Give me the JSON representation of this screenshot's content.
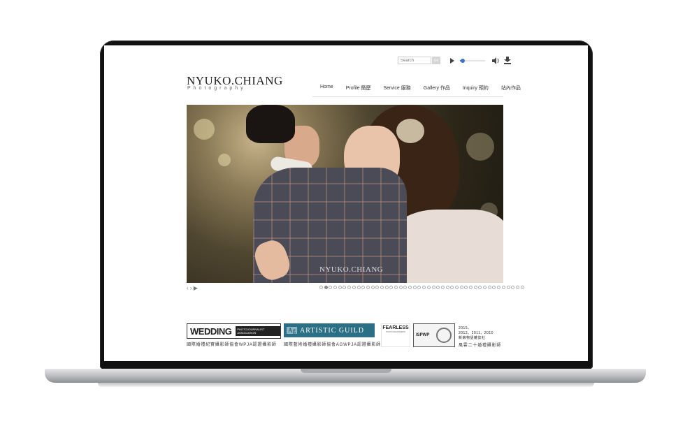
{
  "header": {
    "search_placeholder": "Search",
    "search_button": "Go",
    "audio": {
      "progress": 0.12
    },
    "logo_title": "NYUKO.CHIANG",
    "logo_subtitle": "Photography"
  },
  "nav": {
    "items": [
      {
        "label": "Home"
      },
      {
        "label": "Profile 簡歷"
      },
      {
        "label": "Service 服務"
      },
      {
        "label": "Gallery 作品"
      },
      {
        "label": "Inquiry 預約"
      },
      {
        "label": "站內作品"
      }
    ]
  },
  "hero": {
    "watermark": "NYUKO.CHIANG",
    "controls": "‹ › ▶",
    "slide_count": 44,
    "active_slide": 1
  },
  "badges": {
    "wpja_title": "WEDDING",
    "wpja_side": "PHOTOJOURNALIST ASSOCIATION",
    "wpja_caption": "國際婚禮紀實攝影師協會WPJA認證攝影師",
    "agwpja_ag": "Ag",
    "agwpja_title": "ARTISTIC GUILD",
    "agwpja_caption": "國際藝術婚禮攝影師協會AGWPJA認證攝影師",
    "fearless_title": "FEARLESS",
    "fearless_sub": "PHOTOGRAPHERS",
    "ispwp_title": "ISPWP",
    "years_line1": "2015、",
    "years_line2": "2012、2011、2010",
    "award_line1": "新娘物語雜誌社",
    "award_caption": "風雲二十婚禮攝影師"
  }
}
